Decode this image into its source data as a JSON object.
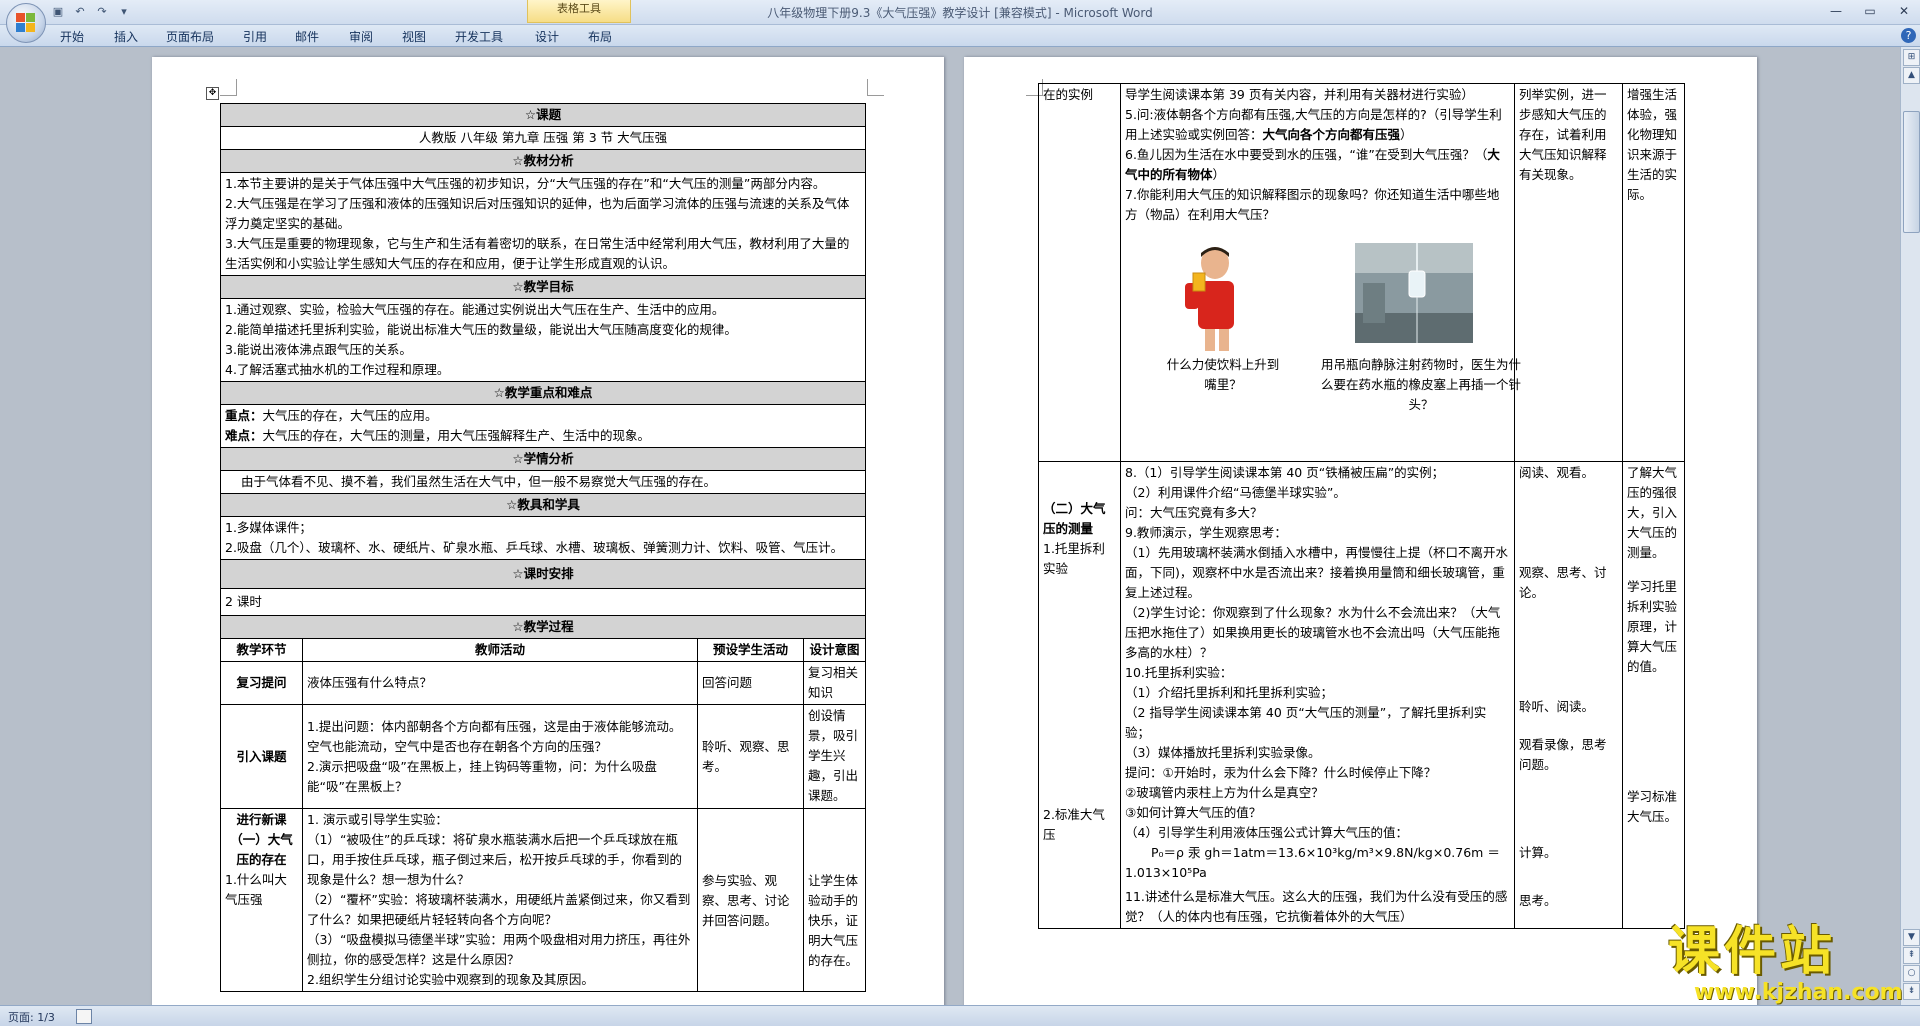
{
  "window": {
    "title": "八年级物理下册9.3《大气压强》教学设计 [兼容模式] - Microsoft Word",
    "context_tab_group": "表格工具"
  },
  "ribbon": {
    "tabs": [
      "开始",
      "插入",
      "页面布局",
      "引用",
      "邮件",
      "审阅",
      "视图",
      "开发工具",
      "设计",
      "布局"
    ],
    "help": "?"
  },
  "status": {
    "page": "页面: 1/3"
  },
  "watermark": {
    "name": "课件站",
    "url": "www.kjzhan.com"
  },
  "left_page": {
    "course_header": "☆课题",
    "course_title": "人教版  八年级  第九章    压强       第 3 节  大气压强",
    "material_header": "☆教材分析",
    "material": [
      "1.本节主要讲的是关于气体压强中大气压强的初步知识，分“大气压强的存在”和“大气压的测量”两部分内容。",
      "2.大气压强是在学习了压强和液体的压强知识后对压强知识的延伸，也为后面学习流体的压强与流速的关系及气体浮力奠定坚实的基础。",
      "3.大气压是重要的物理现象，它与生产和生活有着密切的联系，在日常生活中经常利用大气压，教材利用了大量的生活实例和小实验让学生感知大气压的存在和应用，便于让学生形成直观的认识。"
    ],
    "goals_header": "☆教学目标",
    "goals": [
      "1.通过观察、实验，检验大气压强的存在。能通过实例说出大气压在生产、生活中的应用。",
      "2.能简单描述托里拆利实验，能说出标准大气压的数量级，能说出大气压随高度变化的规律。",
      "3.能说出液体沸点跟气压的关系。",
      "4.了解活塞式抽水机的工作过程和原理。"
    ],
    "keypoints_header": "☆教学重点和难点",
    "key_label": "重点：",
    "key_text": "大气压的存在，大气压的应用。",
    "difficult_label": "难点：",
    "difficult_text": "大气压的存在，大气压的测量，用大气压强解释生产、生活中的现象。",
    "situation_header": "☆学情分析",
    "situation": "由于气体看不见、摸不着，我们虽然生活在大气中，但一般不易察觉大气压强的存在。",
    "tools_header": "☆教具和学具",
    "tools": [
      "1.多媒体课件；",
      "2.吸盘（几个）、玻璃杯、水、硬纸片、矿泉水瓶、乒乓球、水槽、玻璃板、弹簧测力计、饮料、吸管、气压计。"
    ],
    "schedule_header": "☆课时安排",
    "schedule": "2 课时",
    "process_header": "☆教学过程",
    "process_cols": [
      "教学环节",
      "教师活动",
      "预设学生活动",
      "设计意图"
    ],
    "review": {
      "stage": "复习提问",
      "teacher": "液体压强有什么特点？",
      "student": "回答问题",
      "intent": "复习相关知识"
    },
    "intro": {
      "stage": "引入课题",
      "teacher": [
        "1.提出问题：体内部朝各个方向都有压强，这是由于液体能够流动。空气也能流动，空气中是否也存在朝各个方向的压强？",
        "2.演示把吸盘“吸”在黑板上，挂上钩码等重物，问：为什么吸盘能“吸”在黑板上？"
      ],
      "student": "聆听、观察、思考。",
      "intent": "创设情景，吸引学生兴趣，引出课题。"
    },
    "new": {
      "stage": [
        "进行新课",
        "（一）大气压的存在"
      ],
      "sub": "1.什么叫大气压强",
      "teacher": [
        "1. 演示或引导学生实验：",
        "（1）“被吸住”的乒乓球：将矿泉水瓶装满水后把一个乒乓球放在瓶口，用手按住乒乓球，瓶子倒过来后，松开按乒乓球的手，你看到的现象是什么？想一想为什么？",
        "（2）“覆杯”实验：将玻璃杯装满水，用硬纸片盖紧倒过来，你又看到了什么？如果把硬纸片轻轻转向各个方向呢？",
        "（3）“吸盘模拟马德堡半球”实验：用两个吸盘相对用力挤压，再往外侧拉，你的感受怎样？这是什么原因？",
        "2.组织学生分组讨论实验中观察到的现象及其原因。"
      ],
      "student": "参与实验、观察、思考、讨论并回答问题。",
      "intent": "让学生体验动手的快乐，证明大气压的存在。"
    }
  },
  "right_page": {
    "col1": {
      "top": "在的实例",
      "mid": "（二）大气压的测量",
      "sub1": "1.托里拆利实验",
      "sub2": "2.标准大气压"
    },
    "block1": [
      "导学生阅读课本第 39 页有关内容，并利用有关器材进行实验）",
      "5.问:液体朝各个方向都有压强,大气压的方向是怎样的?（引导学生利用上述实验或实例回答：",
      "大气向各个方向都有压强",
      "）",
      "6.鱼儿因为生活在水中要受到水的压强，“谁”在受到大气压强？（",
      "大气中的所有物体",
      "）",
      "7.你能利用大气压的知识解释图示的现象吗？你还知道生活中哪些地方（物品）在利用大气压？"
    ],
    "caption_left": "什么力使饮料上升到嘴里？",
    "caption_right": "用吊瓶向静脉注射药物时，医生为什么要在药水瓶的橡皮塞上再插一个针头？",
    "block1_student": "列举实例，进一步感知大气压的存在，试着利用大气压知识解释有关现象。",
    "block1_intent": "增强生活体验，强化物理知识来源于生活的实际。",
    "block2": [
      "8.（1）引导学生阅读课本第 40 页“铁桶被压扁”的实例；",
      "（2）利用课件介绍“马德堡半球实验”。",
      "问：大气压究竟有多大？",
      "9.教师演示，学生观察思考：",
      "（1）先用玻璃杯装满水倒插入水槽中，再慢慢往上提（杯口不离开水面，下同)，观察杯中水是否流出来？接着换用量筒和细长玻璃管，重复上述过程。",
      "（2)学生讨论：你观察到了什么现象？水为什么不会流出来？（大气压把水拖住了）如果换用更长的玻璃管水也不会流出吗（大气压能拖多高的水柱）？",
      "10.托里拆利实验：",
      "（1）介绍托里拆利和托里拆利实验；",
      "（2 指导学生阅读课本第 40 页“大气压的测量”，了解托里拆利实验；",
      "（3）媒体播放托里拆利实验录像。",
      "提问：①开始时，汞为什么会下降？什么时候停止下降？",
      "②玻璃管内汞柱上方为什么是真空？",
      "③如何计算大气压的值？",
      "（4）引导学生利用液体压强公式计算大气压的值："
    ],
    "formula1": "P₀＝ρ 汞 gh＝1atm＝13.6×10³kg/m³×9.8N/kg×0.76m ＝",
    "formula2": "1.013×10⁵Pa",
    "block3": "11.讲述什么是标准大气压。这么大的压强，我们为什么没有受压的感觉？（人的体内也有压强，它抗衡着体外的大气压）",
    "st_read": "阅读、观看。",
    "st_observe": "观察、思考、讨论。",
    "st_listen": "聆听、阅读。",
    "st_video": "观看录像，思考问题。",
    "st_calc": "计算。",
    "st_think": "思考。",
    "in_know": "了解大气压的强很大，引入大气压的测量。",
    "in_learn": "学习托里拆利实验原理，计算大气压的值。",
    "in_std": "学习标准大气压。"
  }
}
